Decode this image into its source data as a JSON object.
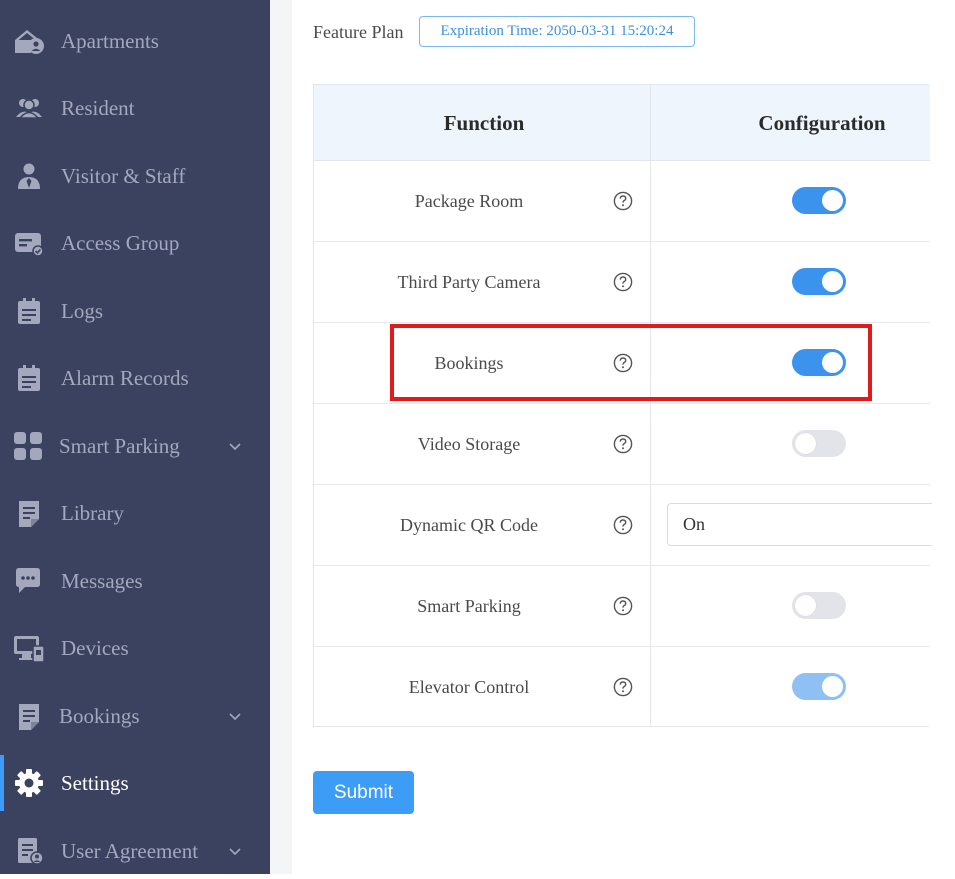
{
  "sidebar": {
    "items": [
      {
        "label": "Apartments",
        "icon": "apartment-icon"
      },
      {
        "label": "Resident",
        "icon": "residents-icon"
      },
      {
        "label": "Visitor & Staff",
        "icon": "visitor-icon"
      },
      {
        "label": "Access Group",
        "icon": "access-card-icon"
      },
      {
        "label": "Logs",
        "icon": "clipboard-icon"
      },
      {
        "label": "Alarm Records",
        "icon": "clipboard-icon"
      },
      {
        "label": "Smart Parking",
        "icon": "grid-icon",
        "expandable": true
      },
      {
        "label": "Library",
        "icon": "document-icon"
      },
      {
        "label": "Messages",
        "icon": "chat-icon"
      },
      {
        "label": "Devices",
        "icon": "devices-icon"
      },
      {
        "label": "Bookings",
        "icon": "document-icon",
        "expandable": true
      },
      {
        "label": "Settings",
        "icon": "gear-icon",
        "active": true
      },
      {
        "label": "User Agreement",
        "icon": "agreement-icon",
        "expandable": true
      }
    ]
  },
  "header": {
    "feature_plan_label": "Feature Plan",
    "expiration": "Expiration Time: 2050-03-31 15:20:24"
  },
  "table": {
    "col_function": "Function",
    "col_configuration": "Configuration",
    "rows": [
      {
        "name": "Package Room",
        "control": "toggle",
        "state": "on"
      },
      {
        "name": "Third Party Camera",
        "control": "toggle",
        "state": "on"
      },
      {
        "name": "Bookings",
        "control": "toggle",
        "state": "on",
        "highlighted": true
      },
      {
        "name": "Video Storage",
        "control": "toggle",
        "state": "off"
      },
      {
        "name": "Dynamic QR Code",
        "control": "select",
        "value": "On"
      },
      {
        "name": "Smart Parking",
        "control": "toggle",
        "state": "off"
      },
      {
        "name": "Elevator Control",
        "control": "toggle",
        "state": "on-disabled"
      }
    ]
  },
  "submit_label": "Submit",
  "colors": {
    "sidebar_bg": "#3b4260",
    "accent": "#3c9bff",
    "highlight": "#e01b1b"
  }
}
